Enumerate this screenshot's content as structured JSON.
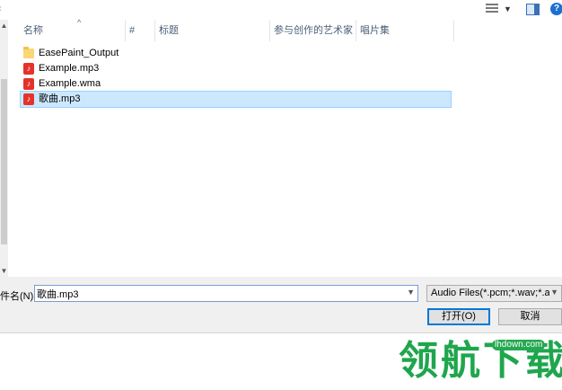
{
  "columns": {
    "name": "名称",
    "number": "#",
    "title": "标题",
    "artists": "参与创作的艺术家",
    "album": "唱片集"
  },
  "files": [
    {
      "name": "EasePaint_Output",
      "icon": "folder-icon",
      "selected": false
    },
    {
      "name": "Example.mp3",
      "icon": "music-file-icon",
      "selected": false
    },
    {
      "name": "Example.wma",
      "icon": "music-file-icon",
      "selected": false
    },
    {
      "name": "歌曲.mp3",
      "icon": "music-file-icon",
      "selected": true
    }
  ],
  "filename": {
    "label": "件名(N):",
    "value": "歌曲.mp3"
  },
  "filetype": {
    "selected": "Audio Files(*.pcm;*.wav;*.amr"
  },
  "buttons": {
    "open": "打开(O)",
    "cancel": "取消"
  },
  "toolbar": {
    "help": "?"
  },
  "watermark": {
    "logo_text": "领航下载",
    "url": "lhdown.com"
  },
  "colors": {
    "selection": "#cce8ff",
    "header_text": "#4c607a",
    "watermark_green": "#1fa64d"
  }
}
